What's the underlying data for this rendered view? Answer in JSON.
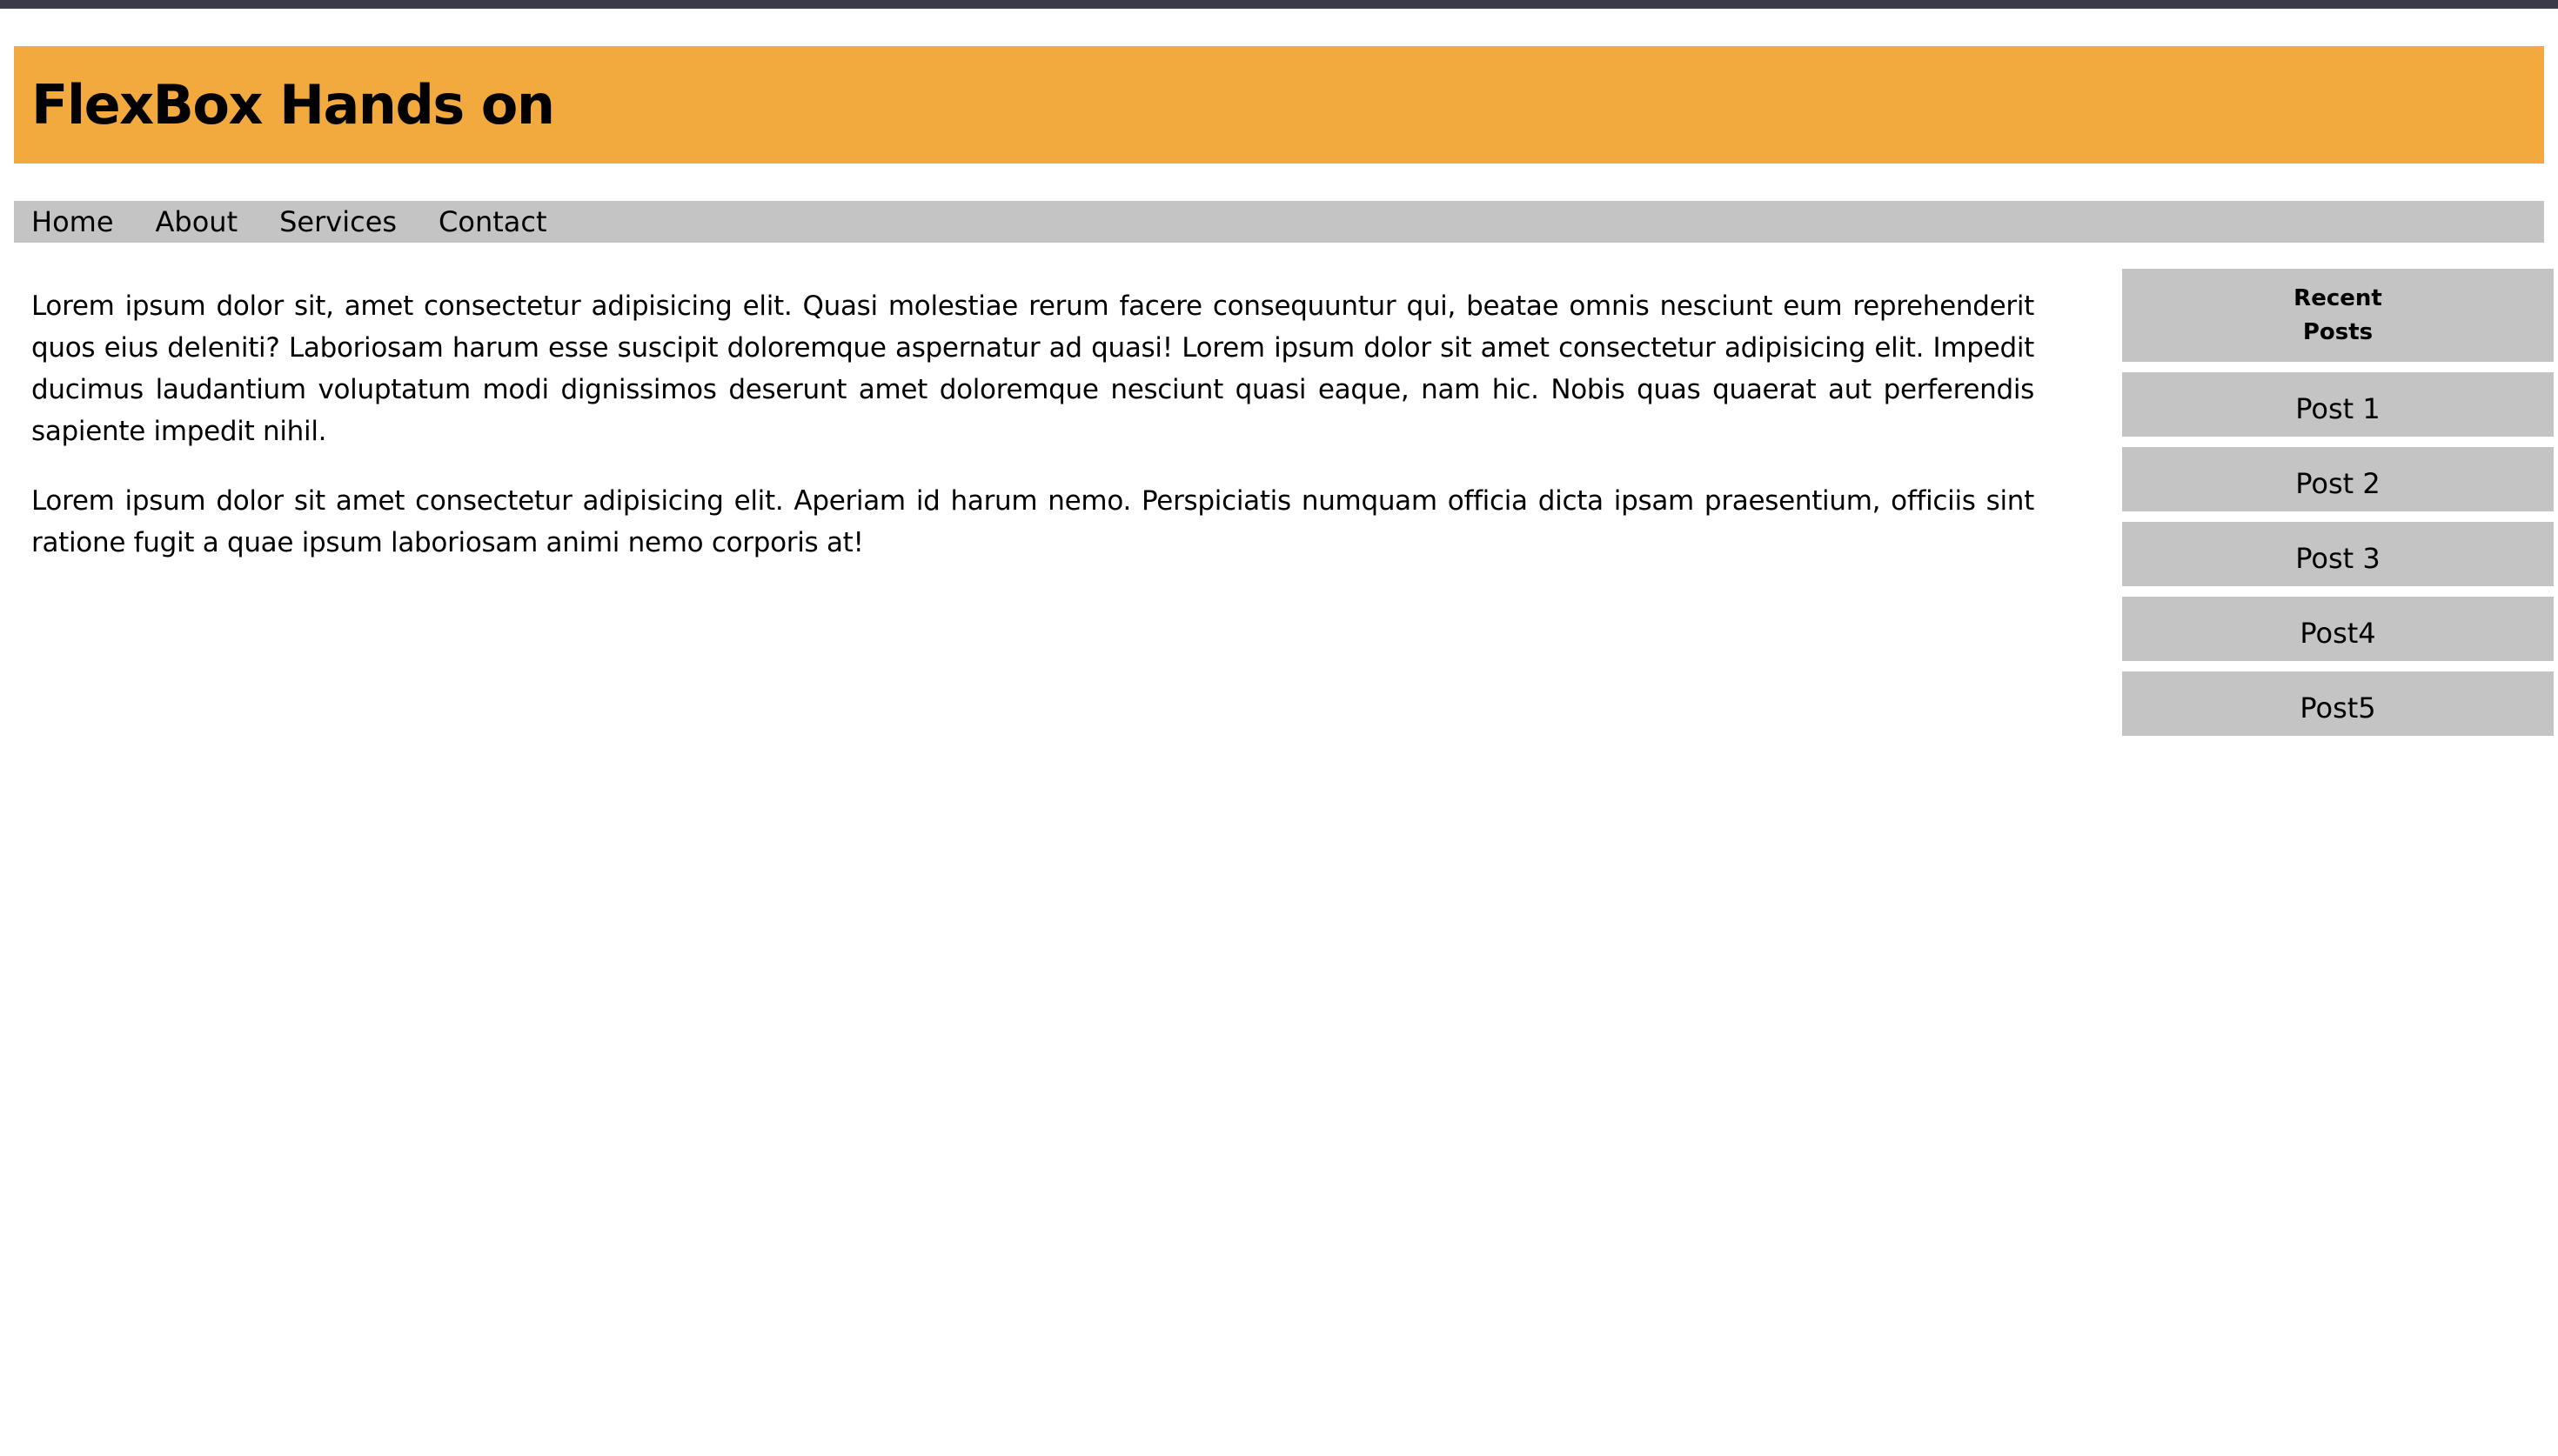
{
  "header": {
    "title": "FlexBox Hands on"
  },
  "nav": {
    "items": [
      {
        "label": "Home"
      },
      {
        "label": "About"
      },
      {
        "label": "Services"
      },
      {
        "label": "Contact"
      }
    ]
  },
  "main": {
    "paragraphs": [
      "Lorem ipsum dolor sit, amet consectetur adipisicing elit. Quasi molestiae rerum facere consequuntur qui, beatae omnis nesciunt eum reprehenderit quos eius deleniti? Laboriosam harum esse suscipit doloremque aspernatur ad quasi! Lorem ipsum dolor sit amet consectetur adipisicing elit. Impedit ducimus laudantium voluptatum modi dignissimos deserunt amet doloremque nesciunt quasi eaque, nam hic. Nobis quas quaerat aut perferendis sapiente impedit nihil.",
      "Lorem ipsum dolor sit amet consectetur adipisicing elit. Aperiam id harum nemo. Perspiciatis numquam officia dicta ipsam praesentium, officiis sint ratione fugit a quae ipsum laboriosam animi nemo corporis at!"
    ]
  },
  "sidebar": {
    "heading": "Recent Posts",
    "posts": [
      {
        "label": "Post 1"
      },
      {
        "label": "Post 2"
      },
      {
        "label": "Post 3"
      },
      {
        "label": "Post4"
      },
      {
        "label": "Post5"
      }
    ]
  },
  "colors": {
    "top_strip": "#3b3a49",
    "header_background": "#f2a93d",
    "nav_background": "#c4c4c4",
    "sidebar_background": "#c4c4c4"
  }
}
